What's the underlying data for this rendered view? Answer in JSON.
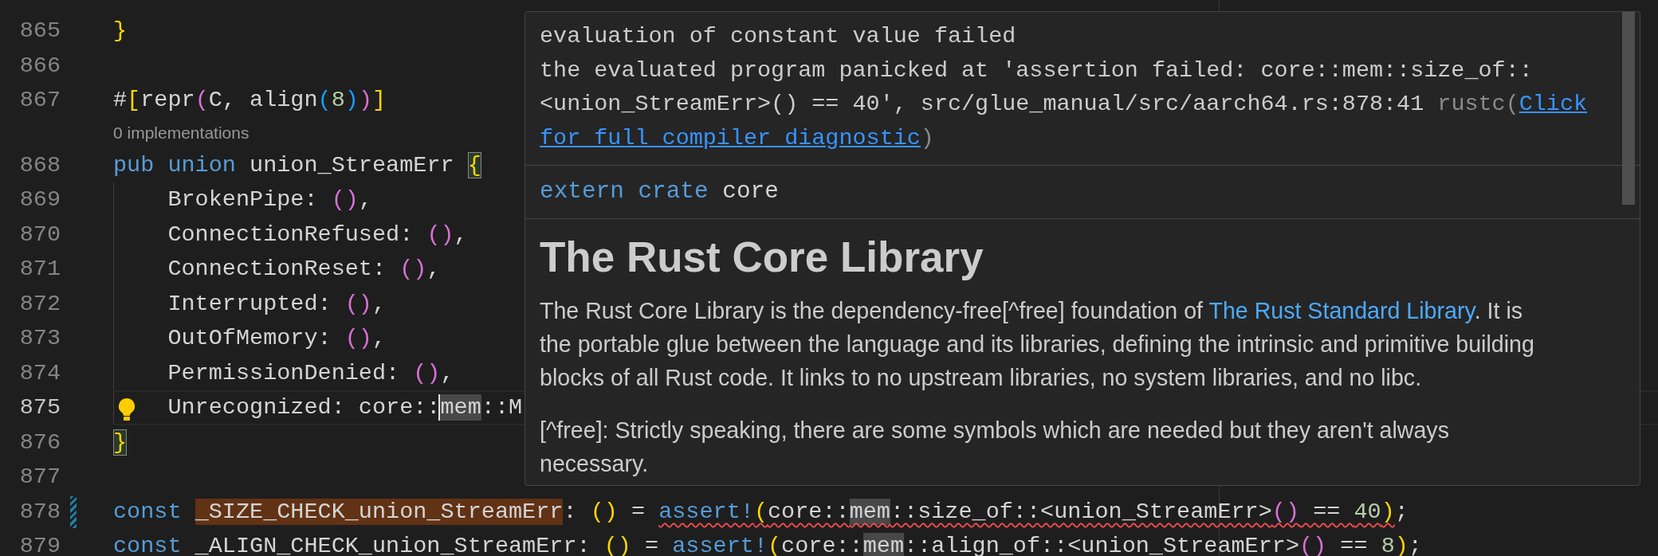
{
  "editor": {
    "lines": [
      {
        "kind": "code",
        "number": "865",
        "current": false,
        "modified": false,
        "lightbulb": false,
        "tokens": [
          {
            "text": "}",
            "kind": "bracket1"
          }
        ]
      },
      {
        "kind": "code",
        "number": "866",
        "current": false,
        "modified": false,
        "lightbulb": false
      },
      {
        "kind": "code",
        "number": "867",
        "current": false,
        "modified": false,
        "lightbulb": false,
        "tokens": [
          {
            "text": "#",
            "kind": "plain"
          },
          {
            "text": "[",
            "kind": "bracket1"
          },
          {
            "text": "repr",
            "kind": "plain"
          },
          {
            "text": "(",
            "kind": "bracket2"
          },
          {
            "text": "C, align",
            "kind": "plain"
          },
          {
            "text": "(",
            "kind": "bracket3"
          },
          {
            "text": "8",
            "kind": "number"
          },
          {
            "text": ")",
            "kind": "bracket3"
          },
          {
            "text": ")",
            "kind": "bracket2"
          },
          {
            "text": "]",
            "kind": "bracket1"
          }
        ]
      },
      {
        "kind": "codelens",
        "text": "0 implementations"
      },
      {
        "kind": "code",
        "number": "868",
        "current": false,
        "modified": false,
        "lightbulb": false,
        "tokens": [
          {
            "text": "pub union",
            "kind": "keyword"
          },
          {
            "text": " union_StreamErr ",
            "kind": "plain"
          },
          {
            "text": "{",
            "kind": "bracket1-match"
          }
        ]
      },
      {
        "kind": "code",
        "number": "869",
        "current": false,
        "modified": false,
        "lightbulb": false,
        "tokens": [
          {
            "text": "    BrokenPipe: ",
            "kind": "plain"
          },
          {
            "text": "()",
            "kind": "bracket2"
          },
          {
            "text": ",",
            "kind": "plain"
          }
        ]
      },
      {
        "kind": "code",
        "number": "870",
        "current": false,
        "modified": false,
        "lightbulb": false,
        "tokens": [
          {
            "text": "    ConnectionRefused: ",
            "kind": "plain"
          },
          {
            "text": "()",
            "kind": "bracket2"
          },
          {
            "text": ",",
            "kind": "plain"
          }
        ]
      },
      {
        "kind": "code",
        "number": "871",
        "current": false,
        "modified": false,
        "lightbulb": false,
        "tokens": [
          {
            "text": "    ConnectionReset: ",
            "kind": "plain"
          },
          {
            "text": "()",
            "kind": "bracket2"
          },
          {
            "text": ",",
            "kind": "plain"
          }
        ]
      },
      {
        "kind": "code",
        "number": "872",
        "current": false,
        "modified": false,
        "lightbulb": false,
        "tokens": [
          {
            "text": "    Interrupted: ",
            "kind": "plain"
          },
          {
            "text": "()",
            "kind": "bracket2"
          },
          {
            "text": ",",
            "kind": "plain"
          }
        ]
      },
      {
        "kind": "code",
        "number": "873",
        "current": false,
        "modified": false,
        "lightbulb": false,
        "tokens": [
          {
            "text": "    OutOfMemory: ",
            "kind": "plain"
          },
          {
            "text": "()",
            "kind": "bracket2"
          },
          {
            "text": ",",
            "kind": "plain"
          }
        ]
      },
      {
        "kind": "code",
        "number": "874",
        "current": false,
        "modified": false,
        "lightbulb": false,
        "tokens": [
          {
            "text": "    PermissionDenied: ",
            "kind": "plain"
          },
          {
            "text": "()",
            "kind": "bracket2"
          },
          {
            "text": ",",
            "kind": "plain"
          }
        ]
      },
      {
        "kind": "code",
        "number": "875",
        "current": true,
        "modified": false,
        "lightbulb": true,
        "tokens": [
          {
            "text": "    Unrecognized: core::",
            "kind": "plain"
          },
          {
            "text": "mem",
            "kind": "occurrence-cursor"
          },
          {
            "text": "::M",
            "kind": "plain"
          }
        ]
      },
      {
        "kind": "code",
        "number": "876",
        "current": false,
        "modified": false,
        "lightbulb": false,
        "tokens": [
          {
            "text": "}",
            "kind": "bracket1-match"
          }
        ]
      },
      {
        "kind": "code",
        "number": "877",
        "current": false,
        "modified": false,
        "lightbulb": false
      },
      {
        "kind": "code",
        "number": "878",
        "current": false,
        "modified": true,
        "lightbulb": false,
        "tokens": [
          {
            "text": "const ",
            "kind": "keyword"
          },
          {
            "text": "_SIZE_CHECK_union_StreamErr",
            "kind": "symbol-highlight"
          },
          {
            "text": ": ",
            "kind": "plain"
          },
          {
            "text": "()",
            "kind": "bracket1"
          },
          {
            "text": " = ",
            "kind": "plain"
          },
          {
            "kind": "error-group",
            "tokens": [
              {
                "text": "assert!",
                "kind": "macro"
              },
              {
                "text": "(",
                "kind": "bracket1"
              },
              {
                "text": "core::",
                "kind": "plain"
              },
              {
                "text": "mem",
                "kind": "occurrence"
              },
              {
                "text": "::size_of::<union_StreamErr>",
                "kind": "plain"
              },
              {
                "text": "()",
                "kind": "bracket2"
              },
              {
                "text": " == ",
                "kind": "plain"
              },
              {
                "text": "40",
                "kind": "number"
              },
              {
                "text": ")",
                "kind": "bracket1"
              }
            ]
          },
          {
            "text": ";",
            "kind": "plain"
          }
        ]
      },
      {
        "kind": "code",
        "number": "879",
        "current": false,
        "modified": false,
        "lightbulb": false,
        "tokens": [
          {
            "text": "const",
            "kind": "keyword"
          },
          {
            "text": " _ALIGN_CHECK_union_StreamErr: ",
            "kind": "plain"
          },
          {
            "text": "()",
            "kind": "bracket1"
          },
          {
            "text": " = ",
            "kind": "plain"
          },
          {
            "text": "assert!",
            "kind": "macro"
          },
          {
            "text": "(",
            "kind": "bracket1"
          },
          {
            "text": "core::",
            "kind": "plain"
          },
          {
            "text": "mem",
            "kind": "occurrence"
          },
          {
            "text": "::align_of::<union_StreamErr>",
            "kind": "plain"
          },
          {
            "text": "()",
            "kind": "bracket2"
          },
          {
            "text": " == ",
            "kind": "plain"
          },
          {
            "text": "8",
            "kind": "number"
          },
          {
            "text": ")",
            "kind": "bracket1"
          },
          {
            "text": ";",
            "kind": "plain"
          }
        ]
      }
    ]
  },
  "hover": {
    "diagnostic": {
      "lines": [
        "evaluation of constant value failed",
        "the evaluated program panicked at 'assertion failed: core::mem::size_of::",
        "<union_StreamErr>() == 40', src/glue_manual/src/aarch64.rs:878:41"
      ],
      "source": "rustc(",
      "link": "Click for full compiler diagnostic",
      "close": ")"
    },
    "signature": [
      {
        "text": "extern crate",
        "kind": "keyword"
      },
      {
        "text": " core",
        "kind": "plain"
      }
    ],
    "doc": {
      "heading": "The Rust Core Library",
      "paragraphs": [
        [
          {
            "text": "The Rust Core Library is the dependency-free[^free] foundation of ",
            "kind": "text"
          },
          {
            "text": "The Rust Standard Library",
            "kind": "link"
          },
          {
            "text": ". It is the portable glue between the language and its libraries, defining the intrinsic and primitive building blocks of all Rust code. It links to no upstream libraries, no system libraries, and no libc.",
            "kind": "text"
          }
        ],
        [
          {
            "text": "[^free]: Strictly speaking, there are some symbols which are needed but they aren't always necessary.",
            "kind": "text"
          }
        ]
      ]
    }
  }
}
